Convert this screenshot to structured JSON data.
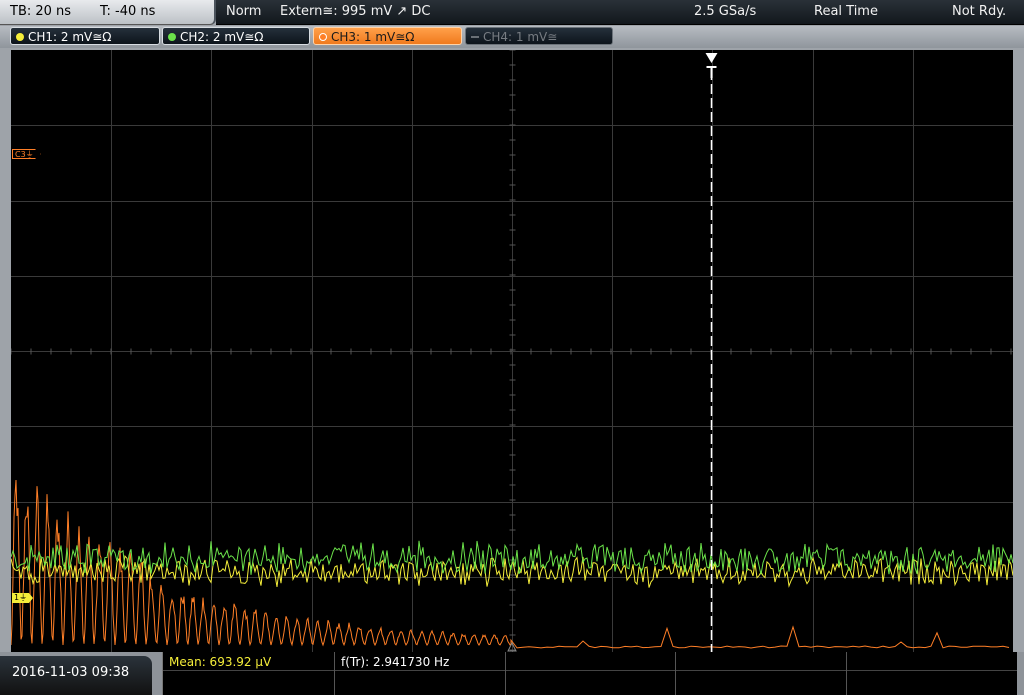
{
  "header": {
    "timebase": "TB: 20 ns",
    "trigger_time": "T: -40 ns",
    "mode": "Norm",
    "trigger_source": "Extern≅: 995 mV ↗ DC",
    "sample_rate": "2.5 GSa/s",
    "acq_mode": "Real Time",
    "status": "Not Rdy."
  },
  "channels": [
    {
      "label": "CH1: 2 mV≅Ω",
      "color": "#f5ee3a",
      "state": "on"
    },
    {
      "label": "CH2: 2 mV≅Ω",
      "color": "#6be24a",
      "state": "on"
    },
    {
      "label": "CH3: 1 mV≅Ω",
      "color": "#ff7f27",
      "state": "active"
    },
    {
      "label": "CH4: 1 mV≅",
      "color": "#6a7076",
      "state": "off"
    }
  ],
  "markers": {
    "c3": "C3⏚",
    "c1": "1⏚"
  },
  "footer": {
    "datetime": "2016-11-03 09:38",
    "mean": "Mean: 693.92 µV",
    "freq": "f(Tr): 2.941730 Hz"
  },
  "colors": {
    "ch1": "#f5ee3a",
    "ch2": "#6be24a",
    "ch3": "#ff7f27",
    "trigger_line": "#ffffff",
    "grid": "#3a3a3a"
  }
}
